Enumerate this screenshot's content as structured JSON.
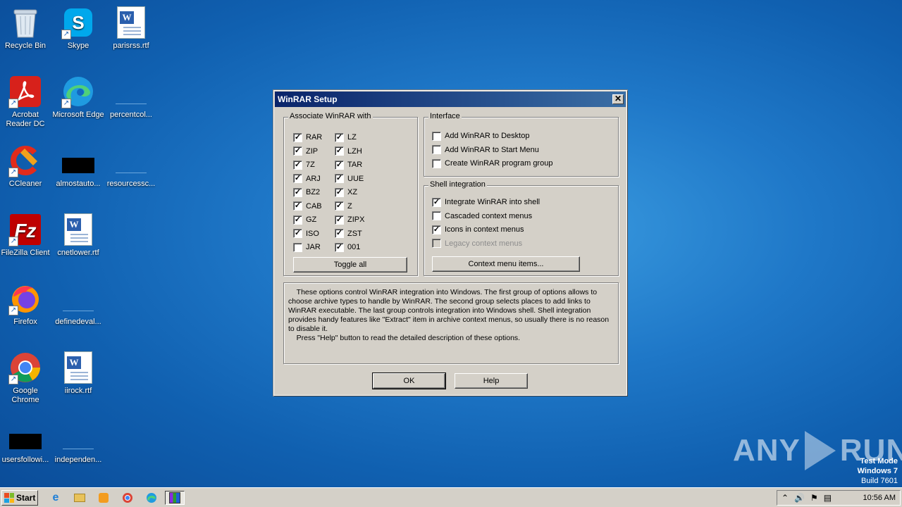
{
  "desktop": {
    "icons": [
      {
        "label": "Recycle Bin",
        "icon": "recycle-bin-icon"
      },
      {
        "label": "Skype",
        "icon": "skype-icon"
      },
      {
        "label": "parisrss.rtf",
        "icon": "word-document-icon"
      },
      {
        "label": "Acrobat Reader DC",
        "icon": "acrobat-reader-icon"
      },
      {
        "label": "Microsoft Edge",
        "icon": "edge-icon"
      },
      {
        "label": "percentcol...",
        "icon": "blank-file-icon"
      },
      {
        "label": "CCleaner",
        "icon": "ccleaner-icon"
      },
      {
        "label": "almostauto...",
        "icon": "black-file-icon"
      },
      {
        "label": "resourcessc...",
        "icon": "blank-file-icon"
      },
      {
        "label": "FileZilla Client",
        "icon": "filezilla-icon"
      },
      {
        "label": "cnetlower.rtf",
        "icon": "word-document-icon"
      },
      {
        "label": "Firefox",
        "icon": "firefox-icon"
      },
      {
        "label": "definedeval...",
        "icon": "blank-file-icon"
      },
      {
        "label": "Google Chrome",
        "icon": "chrome-icon"
      },
      {
        "label": "iirock.rtf",
        "icon": "word-document-icon"
      },
      {
        "label": "usersfollowi...",
        "icon": "black-file-icon"
      },
      {
        "label": "independen...",
        "icon": "blank-file-icon"
      }
    ]
  },
  "dialog": {
    "title": "WinRAR Setup",
    "associate": {
      "title": "Associate WinRAR with",
      "col1": [
        {
          "label": "RAR",
          "checked": true
        },
        {
          "label": "ZIP",
          "checked": true
        },
        {
          "label": "7Z",
          "checked": true
        },
        {
          "label": "ARJ",
          "checked": true
        },
        {
          "label": "BZ2",
          "checked": true
        },
        {
          "label": "CAB",
          "checked": true
        },
        {
          "label": "GZ",
          "checked": true
        },
        {
          "label": "ISO",
          "checked": true
        },
        {
          "label": "JAR",
          "checked": false
        }
      ],
      "col2": [
        {
          "label": "LZ",
          "checked": true
        },
        {
          "label": "LZH",
          "checked": true
        },
        {
          "label": "TAR",
          "checked": true
        },
        {
          "label": "UUE",
          "checked": true
        },
        {
          "label": "XZ",
          "checked": true
        },
        {
          "label": "Z",
          "checked": true
        },
        {
          "label": "ZIPX",
          "checked": true
        },
        {
          "label": "ZST",
          "checked": true
        },
        {
          "label": "001",
          "checked": true
        }
      ],
      "toggle_label": "Toggle all"
    },
    "interface": {
      "title": "Interface",
      "items": [
        {
          "label": "Add WinRAR to Desktop",
          "checked": false
        },
        {
          "label": "Add WinRAR to Start Menu",
          "checked": false
        },
        {
          "label": "Create WinRAR program group",
          "checked": false
        }
      ]
    },
    "shell": {
      "title": "Shell integration",
      "items": [
        {
          "label": "Integrate WinRAR into shell",
          "checked": true,
          "disabled": false
        },
        {
          "label": "Cascaded context menus",
          "checked": false,
          "disabled": false
        },
        {
          "label": "Icons in context menus",
          "checked": true,
          "disabled": false
        },
        {
          "label": "Legacy context menus",
          "checked": false,
          "disabled": true
        }
      ],
      "context_button": "Context menu items..."
    },
    "description": "    These options control WinRAR integration into Windows. The first group of options allows to choose archive types to handle by WinRAR. The second group selects places to add links to WinRAR executable. The last group controls integration into Windows shell. Shell integration provides handy features like \"Extract\" item in archive context menus, so usually there is no reason to disable it.\n    Press \"Help\" button to read the detailed description of these options.",
    "ok_label": "OK",
    "help_label": "Help"
  },
  "watermark": {
    "brand_left": "ANY",
    "brand_right": "RUN",
    "test_mode": "Test Mode",
    "os": "Windows 7",
    "build": "Build 7601"
  },
  "taskbar": {
    "start_label": "Start",
    "clock": "10:56 AM"
  }
}
